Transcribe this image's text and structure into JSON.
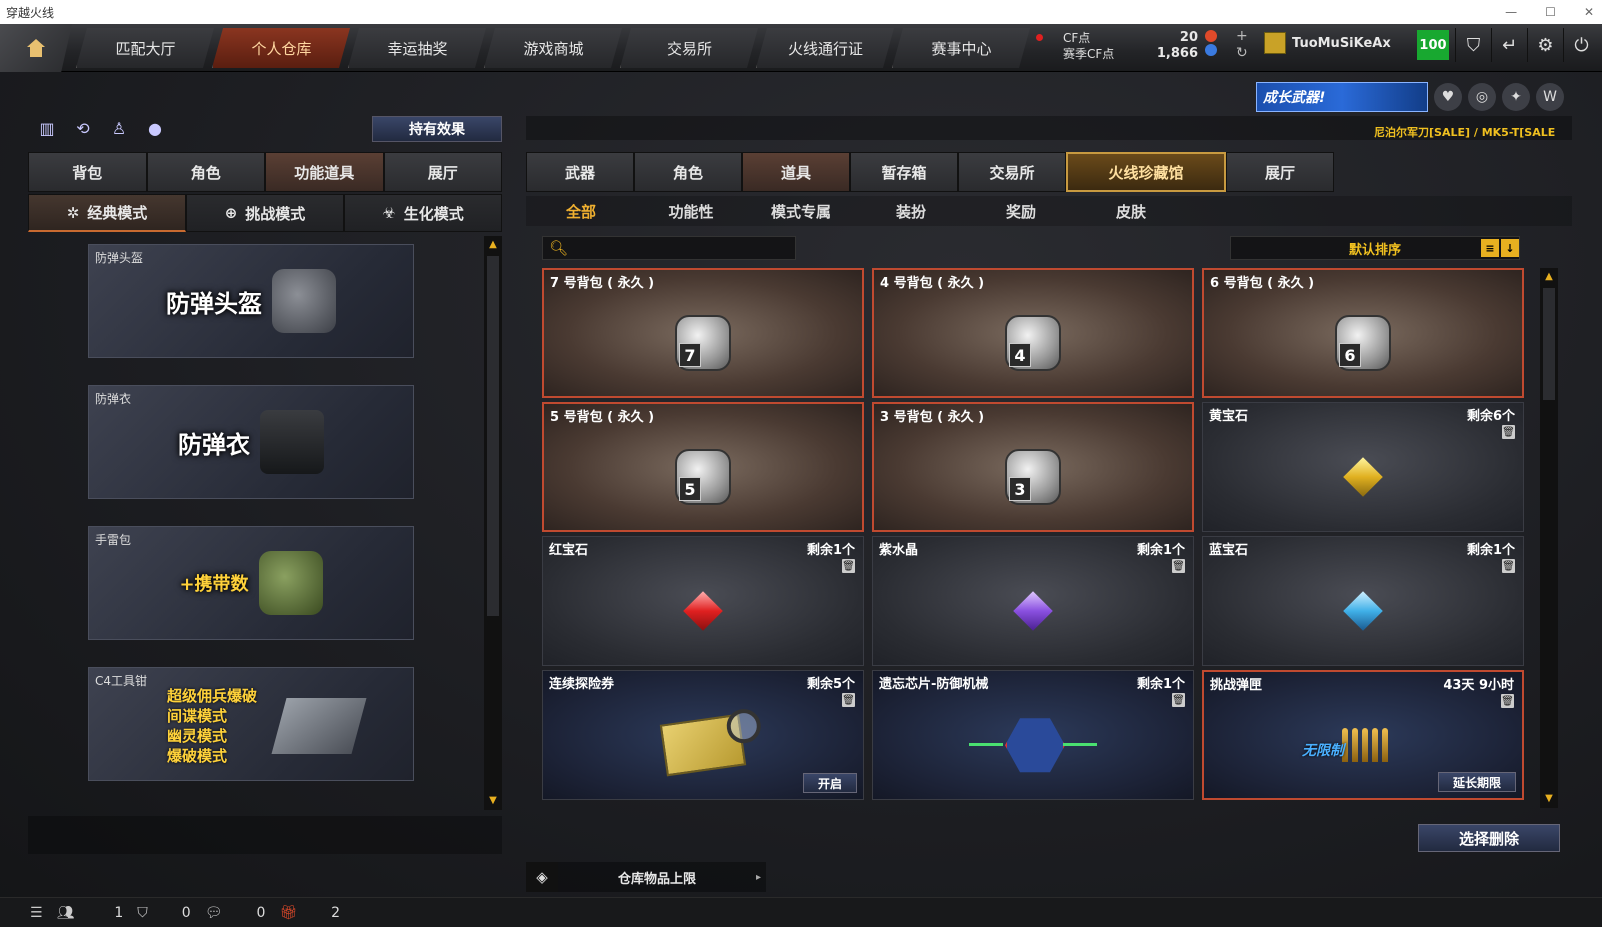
{
  "window": {
    "title": "穿越火线"
  },
  "topnav": {
    "tabs": [
      "匹配大厅",
      "个人仓库",
      "幸运抽奖",
      "游戏商城",
      "交易所",
      "火线通行证",
      "赛事中心"
    ],
    "active_index": 1,
    "currency": {
      "cf_label": "CF点",
      "season_label": "赛季CF点",
      "cf_value": "20",
      "season_value": "1,866"
    },
    "username": "TuoMuSiKeAx",
    "level": "100"
  },
  "promo": {
    "banner_text": "成长武器!",
    "ticker": "尼泊尔军刀[SALE] / MK5-T[SALE"
  },
  "left": {
    "hold_effect_label": "持有效果",
    "tabs": [
      "背包",
      "角色",
      "功能道具",
      "展厅"
    ],
    "active_tab": 2,
    "modes": [
      "经典模式",
      "挑战模式",
      "生化模式"
    ],
    "active_mode": 0,
    "items": [
      {
        "title": "防弹头盔",
        "label": "防弹头盔"
      },
      {
        "title": "防弹衣",
        "label": "防弹衣"
      },
      {
        "title": "手雷包",
        "label": "+携带数"
      },
      {
        "title": "C4工具钳",
        "lines": [
          "超级佣兵爆破",
          "间谍模式",
          "幽灵模式",
          "爆破模式"
        ]
      }
    ]
  },
  "right": {
    "tabs": [
      "武器",
      "角色",
      "道具",
      "暂存箱",
      "交易所",
      "火线珍藏馆",
      "展厅"
    ],
    "active_tab": 2,
    "subtabs": [
      "全部",
      "功能性",
      "模式专属",
      "装扮",
      "奖励",
      "皮肤"
    ],
    "active_subtab": 0,
    "search_placeholder": "",
    "sort_label": "默认排序",
    "items": [
      {
        "name": "7 号背包 ( 永久 )",
        "type": "bag",
        "num": "7"
      },
      {
        "name": "4 号背包 ( 永久 )",
        "type": "bag",
        "num": "4"
      },
      {
        "name": "6 号背包 ( 永久 )",
        "type": "bag",
        "num": "6"
      },
      {
        "name": "5 号背包 ( 永久 )",
        "type": "bag",
        "num": "5"
      },
      {
        "name": "3 号背包 ( 永久 )",
        "type": "bag",
        "num": "3"
      },
      {
        "name": "黄宝石",
        "count": "剩余6个",
        "type": "gem",
        "color": "yellow"
      },
      {
        "name": "红宝石",
        "count": "剩余1个",
        "type": "gem",
        "color": "red"
      },
      {
        "name": "紫水晶",
        "count": "剩余1个",
        "type": "gem",
        "color": "purple"
      },
      {
        "name": "蓝宝石",
        "count": "剩余1个",
        "type": "gem",
        "color": "blue"
      },
      {
        "name": "连续探险券",
        "count": "剩余5个",
        "type": "map",
        "button": "开启"
      },
      {
        "name": "遗忘芯片-防御机械",
        "count": "剩余1个",
        "type": "chip"
      },
      {
        "name": "挑战弹匣",
        "count": "43天 9小时",
        "type": "ammo",
        "button": "延长期限",
        "tag": "无限制"
      }
    ],
    "select_delete_label": "选择删除",
    "warehouse_limit_label": "仓库物品上限"
  },
  "statusbar": {
    "friends": "1",
    "guild": "0",
    "messages": "0",
    "gifts": "2"
  },
  "colors": {
    "accent_orange": "#f0b030",
    "bag_border": "#c04a30",
    "level_green": "#18a830"
  }
}
